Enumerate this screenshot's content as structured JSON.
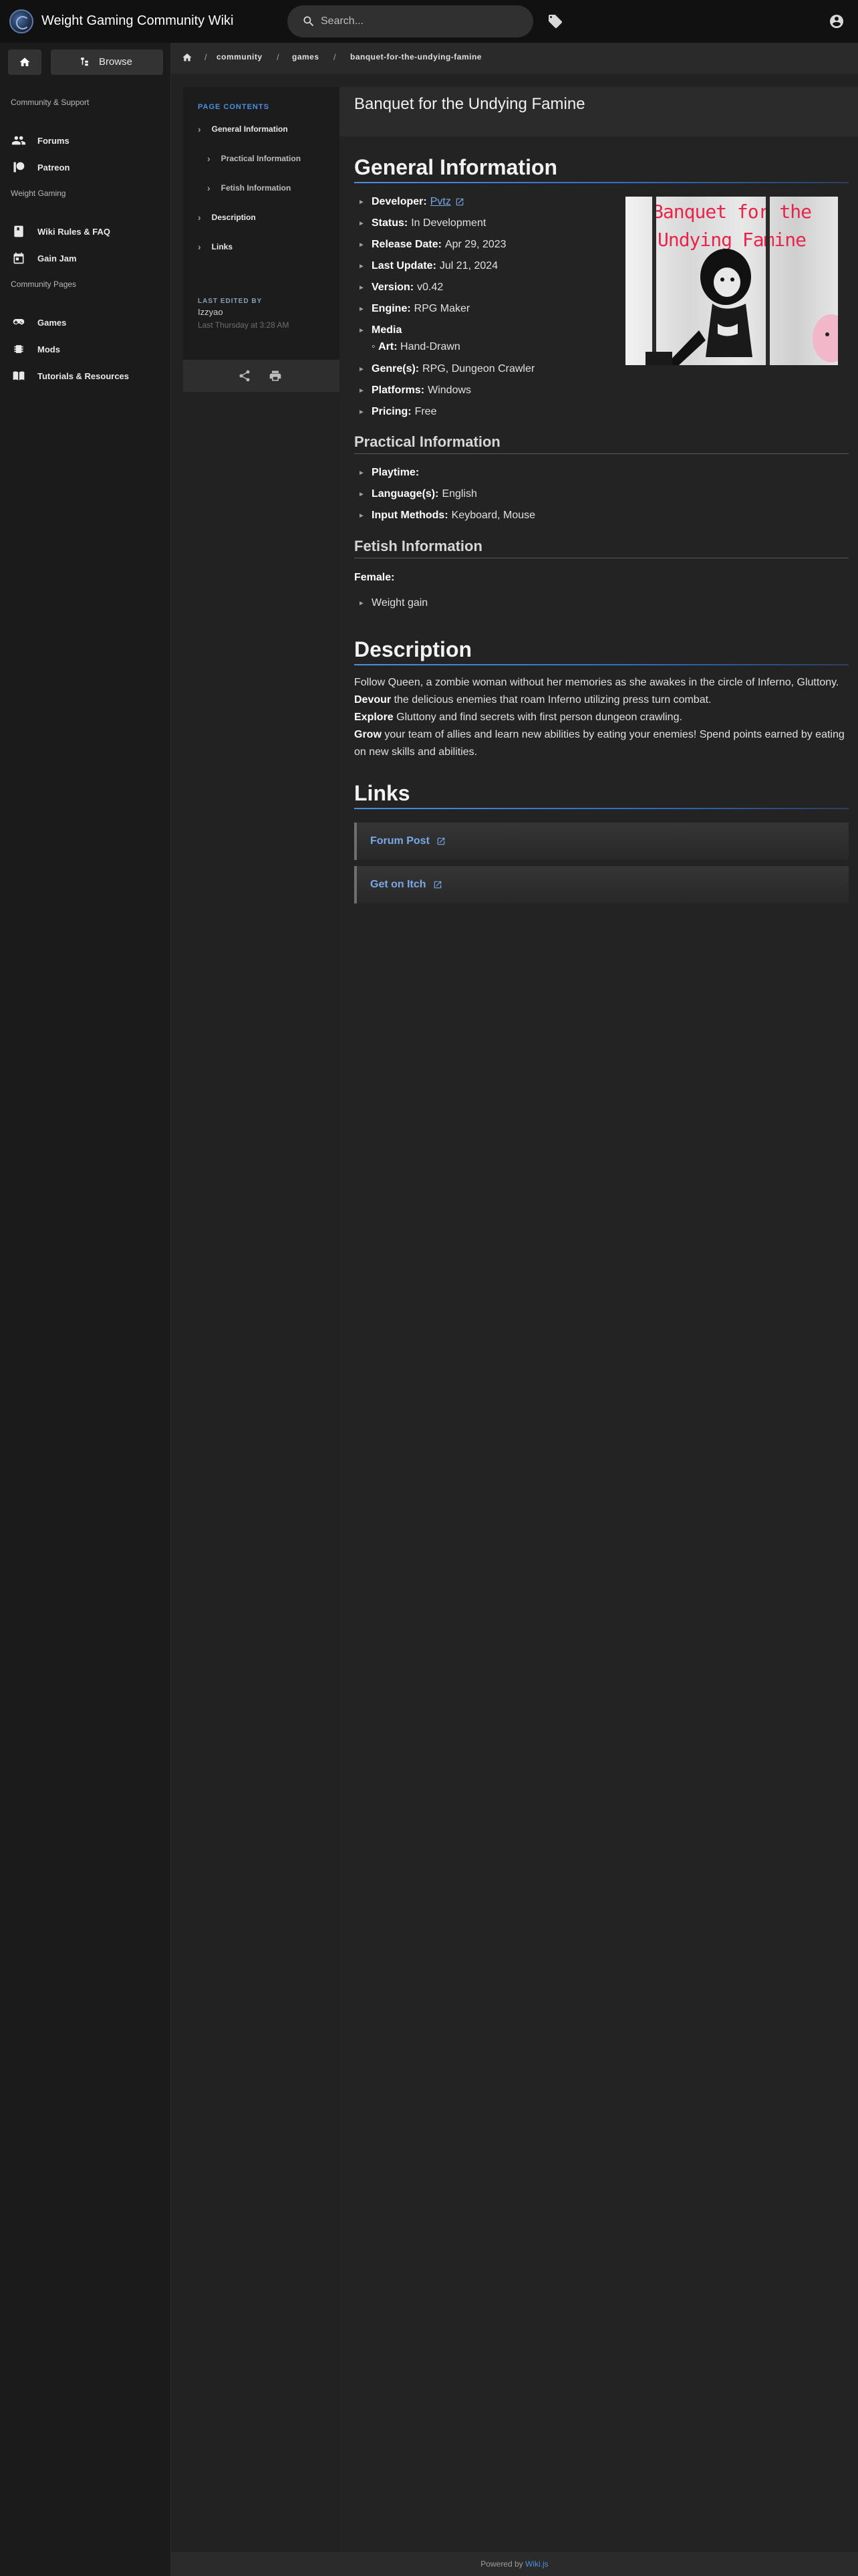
{
  "header": {
    "site_title": "Weight Gaming Community Wiki",
    "search_placeholder": "Search..."
  },
  "sidebar": {
    "browse_label": "Browse",
    "sections": [
      {
        "label": "Community & Support"
      },
      {
        "label": "Weight Gaming"
      },
      {
        "label": "Community Pages"
      }
    ],
    "items": [
      {
        "label": "Forums",
        "icon": "people-icon"
      },
      {
        "label": "Patreon",
        "icon": "patreon-icon"
      },
      {
        "label": "Wiki Rules & FAQ",
        "icon": "book-icon"
      },
      {
        "label": "Gain Jam",
        "icon": "calendar-icon"
      },
      {
        "label": "Games",
        "icon": "gamepad-icon"
      },
      {
        "label": "Mods",
        "icon": "memory-icon"
      },
      {
        "label": "Tutorials & Resources",
        "icon": "book-open-icon"
      }
    ]
  },
  "breadcrumb": [
    "community",
    "games",
    "banquet-for-the-undying-famine"
  ],
  "page_title": "Banquet for the Undying Famine",
  "toc": {
    "header": "PAGE CONTENTS",
    "items": [
      {
        "label": "General Information"
      },
      {
        "label": "Practical Information"
      },
      {
        "label": "Fetish Information"
      },
      {
        "label": "Description"
      },
      {
        "label": "Links"
      }
    ],
    "last_edited_label": "LAST EDITED BY",
    "last_edited_user": "Izzyao",
    "last_edited_time": "Last Thursday at 3:28 AM"
  },
  "general": {
    "heading": "General Information",
    "developer_label": "Developer:",
    "developer": "Pvtz",
    "status_label": "Status:",
    "status": "In Development",
    "release_label": "Release Date:",
    "release": "Apr 29, 2023",
    "update_label": "Last Update:",
    "update": "Jul 21, 2024",
    "version_label": "Version:",
    "version": "v0.42",
    "engine_label": "Engine:",
    "engine": "RPG Maker",
    "media_label": "Media",
    "art_prefix": "◦",
    "art_label": "Art:",
    "art": "Hand-Drawn",
    "genre_label": "Genre(s):",
    "genre": "RPG, Dungeon Crawler",
    "platforms_label": "Platforms:",
    "platforms": "Windows",
    "pricing_label": "Pricing:",
    "pricing": "Free",
    "cover_title_line1": "Banquet for the",
    "cover_title_line2": "Undying Famine"
  },
  "practical": {
    "heading": "Practical Information",
    "playtime_label": "Playtime:",
    "playtime": "",
    "language_label": "Language(s):",
    "language": "English",
    "input_label": "Input Methods:",
    "input": "Keyboard, Mouse"
  },
  "fetish": {
    "heading": "Fetish Information",
    "female_label": "Female:",
    "items": [
      "Weight gain"
    ]
  },
  "description": {
    "heading": "Description",
    "line1": "Follow Queen, a zombie woman without her memories as she awakes in the circle of Inferno, Gluttony.",
    "line2_bold": "Devour",
    "line2": " the delicious enemies that roam Inferno utilizing press turn combat.",
    "line3_bold": "Explore",
    "line3": " Gluttony and find secrets with first person dungeon crawling.",
    "line4_bold": "Grow",
    "line4": " your team of allies and learn new abilities by eating your enemies! Spend points earned by eating on new skills and abilities."
  },
  "links": {
    "heading": "Links",
    "items": [
      {
        "label": "Forum Post"
      },
      {
        "label": "Get on Itch"
      }
    ]
  },
  "footer": {
    "prefix": "Powered by",
    "brand": "Wiki.js"
  }
}
